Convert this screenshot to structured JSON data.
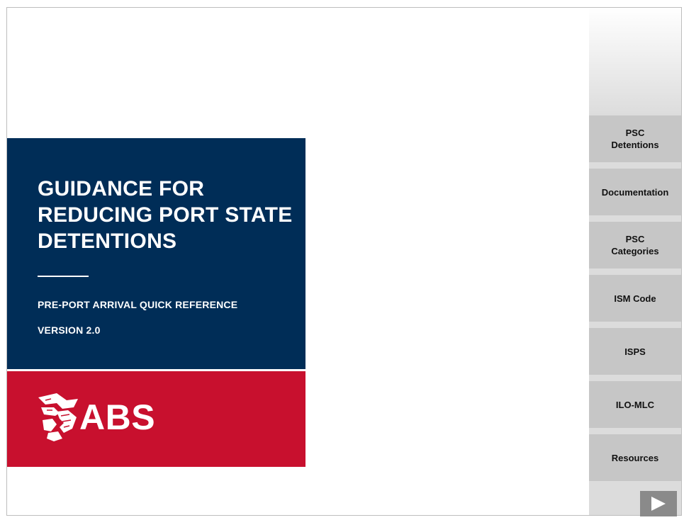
{
  "cover": {
    "title": "GUIDANCE FOR REDUCING PORT STATE DETENTIONS",
    "subtitle": "PRE-PORT ARRIVAL QUICK REFERENCE",
    "version": "VERSION 2.0",
    "logo_text": "ABS",
    "colors": {
      "navy": "#002d57",
      "red": "#c8102e"
    }
  },
  "sidebar": {
    "items": [
      {
        "label": "PSC Detentions"
      },
      {
        "label": "Documentation"
      },
      {
        "label": "PSC Categories"
      },
      {
        "label": "ISM Code"
      },
      {
        "label": "ISPS"
      },
      {
        "label": "ILO-MLC"
      },
      {
        "label": "Resources"
      }
    ],
    "next_icon": "play-arrow-icon"
  }
}
